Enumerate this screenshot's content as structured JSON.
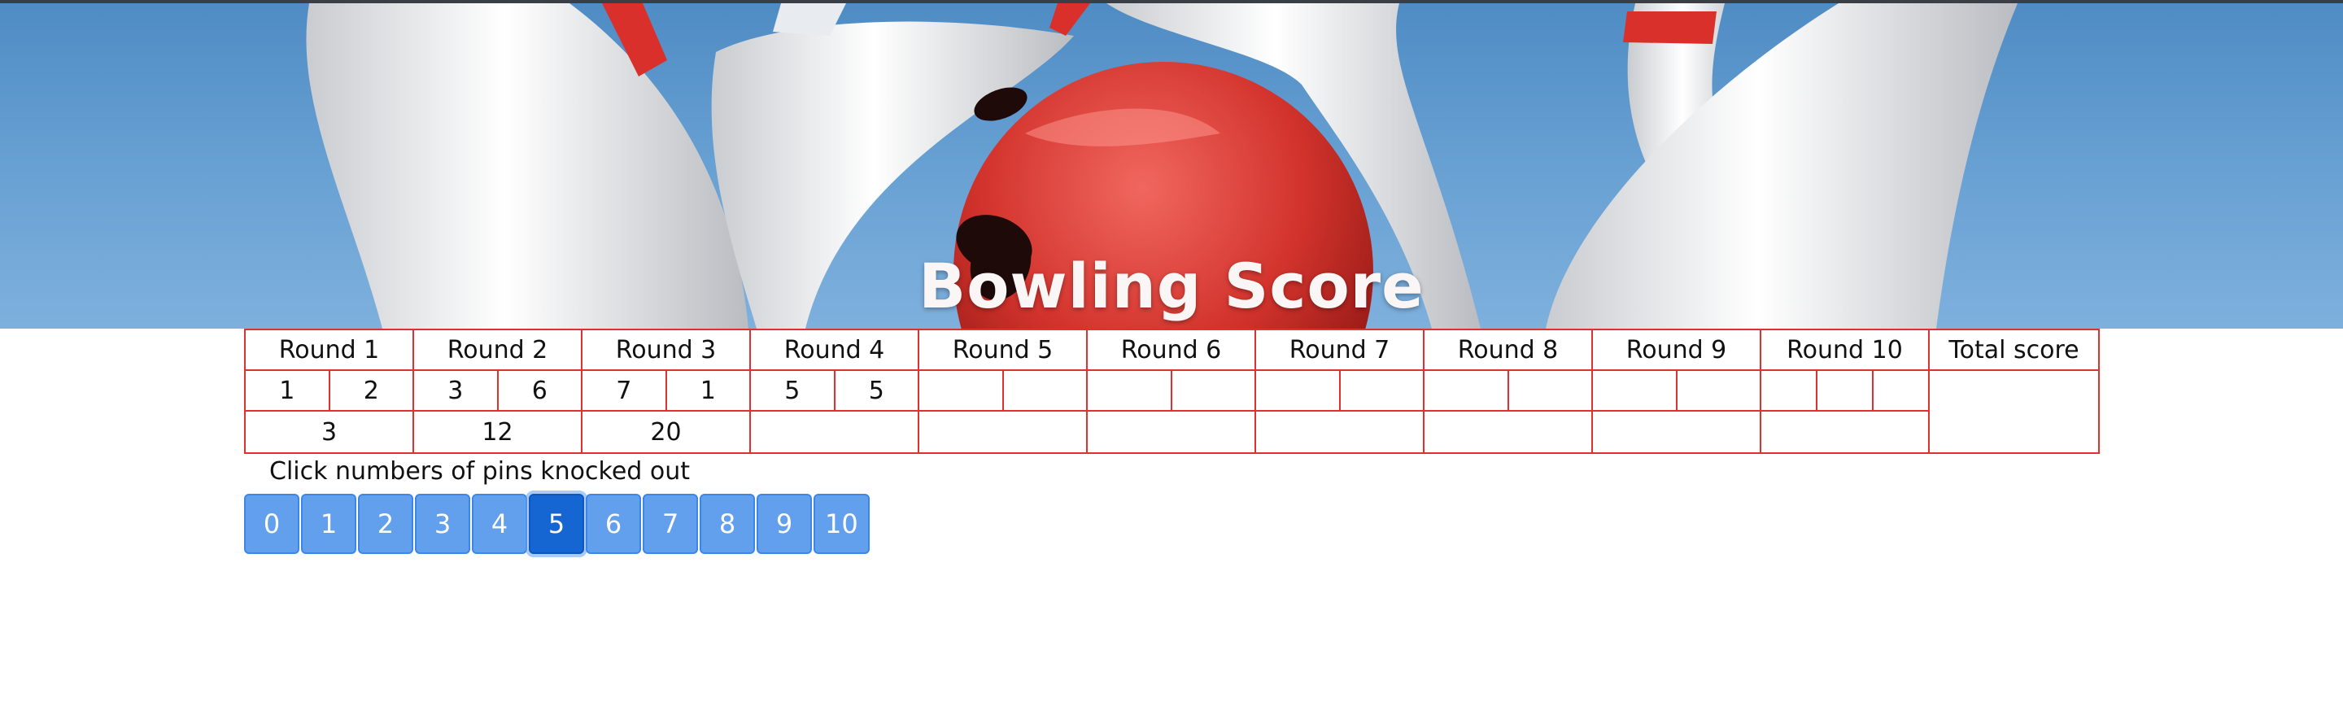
{
  "header": {
    "title": "Bowling Score"
  },
  "table": {
    "columns": [
      "Round 1",
      "Round 2",
      "Round 3",
      "Round 4",
      "Round 5",
      "Round 6",
      "Round 7",
      "Round 8",
      "Round 9",
      "Round 10",
      "Total score"
    ],
    "throws": [
      [
        "1",
        "2"
      ],
      [
        "3",
        "6"
      ],
      [
        "7",
        "1"
      ],
      [
        "5",
        "5"
      ],
      [
        "",
        ""
      ],
      [
        "",
        ""
      ],
      [
        "",
        ""
      ],
      [
        "",
        ""
      ],
      [
        "",
        ""
      ],
      [
        "",
        "",
        ""
      ]
    ],
    "totals": [
      "3",
      "12",
      "20",
      "",
      "",
      "",
      "",
      "",
      "",
      ""
    ],
    "total_score": ""
  },
  "pins": {
    "prompt": "Click numbers of pins knocked out",
    "options": [
      "0",
      "1",
      "2",
      "3",
      "4",
      "5",
      "6",
      "7",
      "8",
      "9",
      "10"
    ],
    "selected": "5"
  },
  "colors": {
    "grid": "#e2302f",
    "button": "#62a0ee",
    "button_active": "#1565d2"
  }
}
